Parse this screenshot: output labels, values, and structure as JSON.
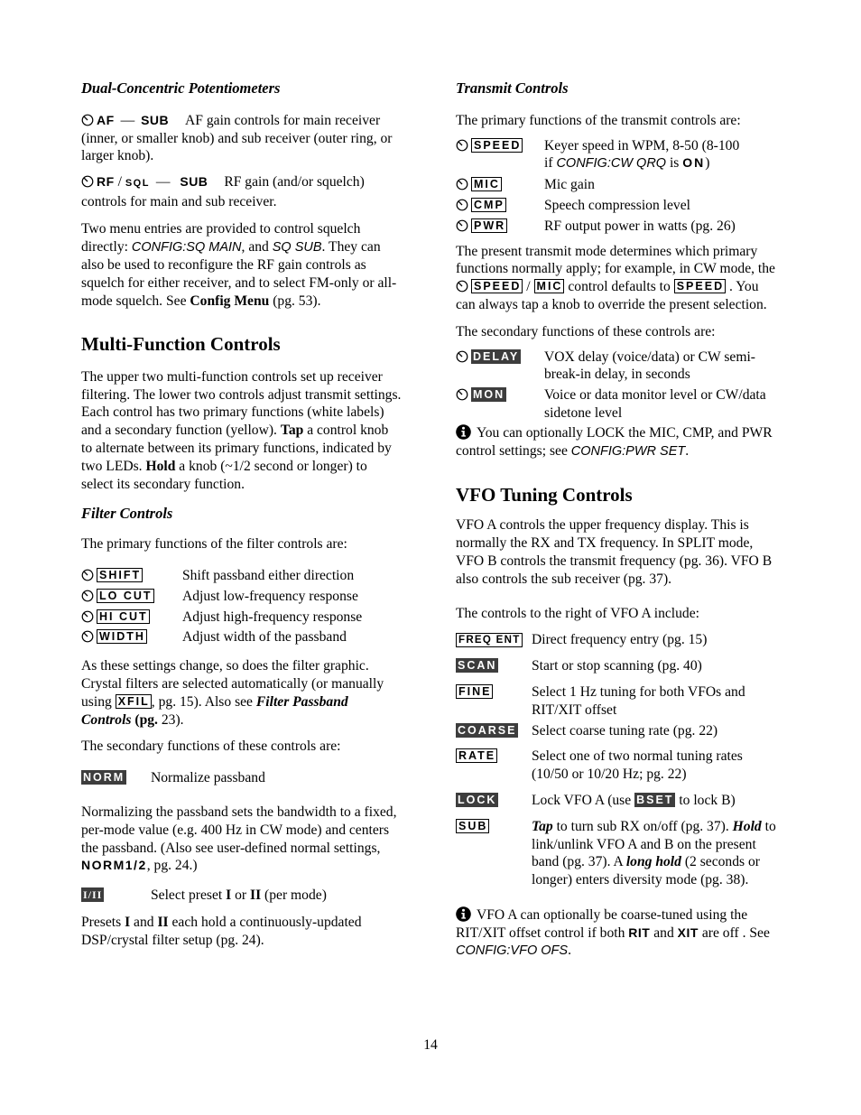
{
  "left": {
    "dual": {
      "heading": "Dual-Concentric Potentiometers",
      "af": {
        "k1": "AF",
        "dash": "—",
        "k2": "SUB",
        "text1": "AF gain controls for main",
        "text2": "receiver (inner, or smaller knob) and sub receiver (outer ring, or larger knob)."
      },
      "rf": {
        "k1": "RF",
        "slash": "/",
        "k1b": "SQL",
        "dash": "—",
        "k2": "SUB",
        "text1": "RF gain (and/or squelch)",
        "text2": "controls for main and sub receiver."
      },
      "p1": {
        "a": "Two menu entries are provided to control squelch directly: ",
        "m1": "CONFIG:SQ MAIN",
        "b": ", and ",
        "m2": "SQ SUB",
        "c": ". They can also be used to reconfigure the RF gain controls as squelch for either receiver, and to select FM-only or all-mode squelch. See ",
        "bold": "Config Menu",
        "d": " (pg. 53)."
      }
    },
    "multi": {
      "heading": "Multi-Function Controls",
      "p1": {
        "a": "The upper two multi-function controls set up receiver filtering. The lower two controls adjust transmit settings. Each control has two primary functions (white labels) and a secondary function (yellow). ",
        "tap": "Tap",
        "b": " a control knob to alternate between its primary functions, indicated by two LEDs. ",
        "hold": "Hold",
        "c": " a knob (~1/2 second or longer) to select its secondary function."
      }
    },
    "filter": {
      "heading": "Filter Controls",
      "intro": "The primary functions of the filter controls are:",
      "primary": [
        {
          "key": "SHIFT",
          "desc": "Shift passband either direction"
        },
        {
          "key": "LO CUT",
          "desc": "Adjust low-frequency response"
        },
        {
          "key": "HI CUT",
          "desc": "Adjust high-frequency response"
        },
        {
          "key": "WIDTH",
          "desc": "Adjust width of the passband"
        }
      ],
      "p2": {
        "a": "As these settings change, so does the filter graphic. Crystal filters are selected automatically (or manually using ",
        "key": "XFIL",
        "b": ", pg. 15). Also see ",
        "bi": "Filter Passband Controls",
        "c": " ",
        "bold": "(pg.",
        "d": " 23)."
      },
      "secondary_intro": "The secondary functions of these controls are:",
      "norm": {
        "key": "NORM",
        "desc": "Normalize passband"
      },
      "p3": {
        "a": "Normalizing the passband sets the bandwidth to a fixed, per-mode value (e.g. 400 Hz in CW mode) and centers the passband. (Also see user-defined normal settings, ",
        "bold": "NORM1/2",
        "b": ", pg. 24.)"
      },
      "preset": {
        "key": "I/II",
        "a": "Select preset ",
        "b1": "I",
        "b": " or ",
        "b2": "II",
        "c": " (per mode)"
      },
      "p4": {
        "a": "Presets ",
        "b1": "I",
        "b": " and ",
        "b2": "II",
        "c": " each hold a continuously-updated DSP/crystal filter setup (pg. 24)."
      }
    }
  },
  "right": {
    "transmit": {
      "heading": "Transmit Controls",
      "intro": "The primary functions of the transmit controls are:",
      "speed": {
        "key": "SPEED",
        "desc1": "Keyer speed in WPM, 8-50 (8-100",
        "desc2a": "if ",
        "desc2m": "CONFIG:CW QRQ",
        "desc2b": " is ",
        "desc2k": "ON",
        "desc2c": ")"
      },
      "primary": [
        {
          "key": "MIC",
          "desc": "Mic gain"
        },
        {
          "key": "CMP",
          "desc": "Speech compression level"
        },
        {
          "key": "PWR",
          "desc": "RF output power in watts (pg. 26)"
        }
      ],
      "p1": {
        "a": "The present transmit mode determines which primary functions normally apply; for example, in CW mode, the ",
        "k1": "SPEED",
        "slash": " / ",
        "k2": "MIC",
        "b": " control defaults to ",
        "k3": "SPEED",
        "c": " . You can always tap a knob to override the present selection."
      },
      "secondary_intro": "The secondary functions of these controls are:",
      "secondary": [
        {
          "key": "DELAY",
          "desc": "VOX delay (voice/data) or CW semi-break-in delay, in seconds"
        },
        {
          "key": "MON",
          "desc": "Voice or data monitor level or CW/data sidetone level"
        }
      ],
      "note": {
        "a": "You can optionally LOCK the MIC, CMP, and PWR control settings; see ",
        "m": "CONFIG:PWR SET",
        "b": "."
      }
    },
    "vfo": {
      "heading": "VFO Tuning Controls",
      "p1": "VFO A controls the upper frequency display. This is normally the RX and TX frequency. In SPLIT mode, VFO B controls the transmit frequency (pg. 36). VFO B also controls the sub receiver (pg. 37).",
      "intro": "The controls to the right of VFO A include:",
      "controls": [
        {
          "key": "FREQ ENT",
          "style": "box",
          "desc": "Direct frequency entry (pg. 15)"
        },
        {
          "key": "SCAN",
          "style": "inv",
          "desc": "Start or stop scanning (pg. 40)"
        },
        {
          "key": "FINE",
          "style": "box",
          "desc": "Select 1 Hz tuning for both VFOs and RIT/XIT offset"
        },
        {
          "key": "COARSE",
          "style": "inv",
          "desc": "Select coarse tuning rate (pg. 22)"
        },
        {
          "key": "RATE",
          "style": "box",
          "desc": "Select one of two normal tuning rates (10/50 or 10/20 Hz; pg. 22)"
        }
      ],
      "lock": {
        "key": "LOCK",
        "a": "Lock VFO A (use ",
        "k2": "BSET",
        "b": " to lock B)"
      },
      "sub": {
        "key": "SUB",
        "tap": "Tap",
        "a": " to turn sub RX on/off (pg. 37). ",
        "hold": "Hold",
        "b": " to link/unlink VFO A and B on the present band (pg. 37). A ",
        "long": "long hold",
        "c": " (2 seconds or longer) enters diversity mode (pg. 38)."
      },
      "note": {
        "a": "VFO A can optionally be coarse-tuned using the RIT/XIT offset control if both ",
        "k1": "RIT",
        "b": " and ",
        "k2": "XIT",
        "c": " are off . See ",
        "m": "CONFIG:VFO OFS",
        "d": "."
      }
    }
  },
  "page_number": "14"
}
